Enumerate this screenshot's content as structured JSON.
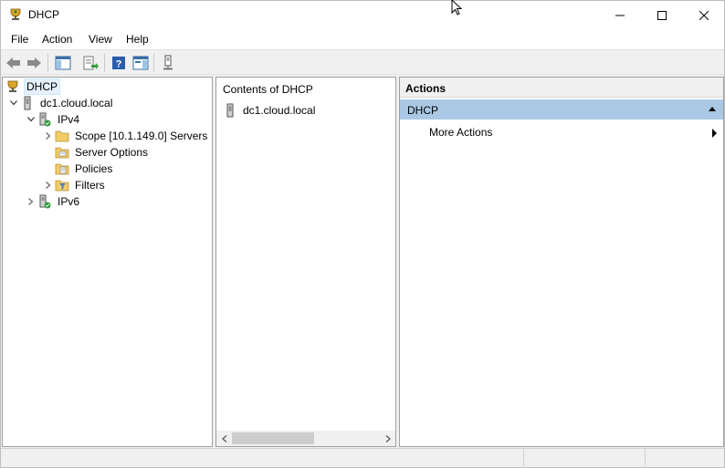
{
  "window": {
    "title": "DHCP"
  },
  "menubar": {
    "items": [
      "File",
      "Action",
      "View",
      "Help"
    ]
  },
  "toolbar": {
    "buttons": [
      "back-arrow-icon",
      "forward-arrow-icon",
      "show-hide-tree-icon",
      "export-list-icon",
      "help-icon",
      "show-hide-action-pane-icon",
      "connect-server-icon"
    ]
  },
  "tree": {
    "root": "DHCP",
    "server": "dc1.cloud.local",
    "ipv4": "IPv4",
    "scope": "Scope [10.1.149.0] Servers",
    "server_options": "Server Options",
    "policies": "Policies",
    "filters": "Filters",
    "ipv6": "IPv6"
  },
  "content": {
    "header": "Contents of DHCP",
    "items": [
      "dc1.cloud.local"
    ]
  },
  "actions": {
    "title": "Actions",
    "group": "DHCP",
    "items": [
      "More Actions"
    ]
  },
  "colors": {
    "selection": "#e5f1fb",
    "actions_group_bg": "#aac8e4",
    "pane_border": "#a0a0a0"
  }
}
